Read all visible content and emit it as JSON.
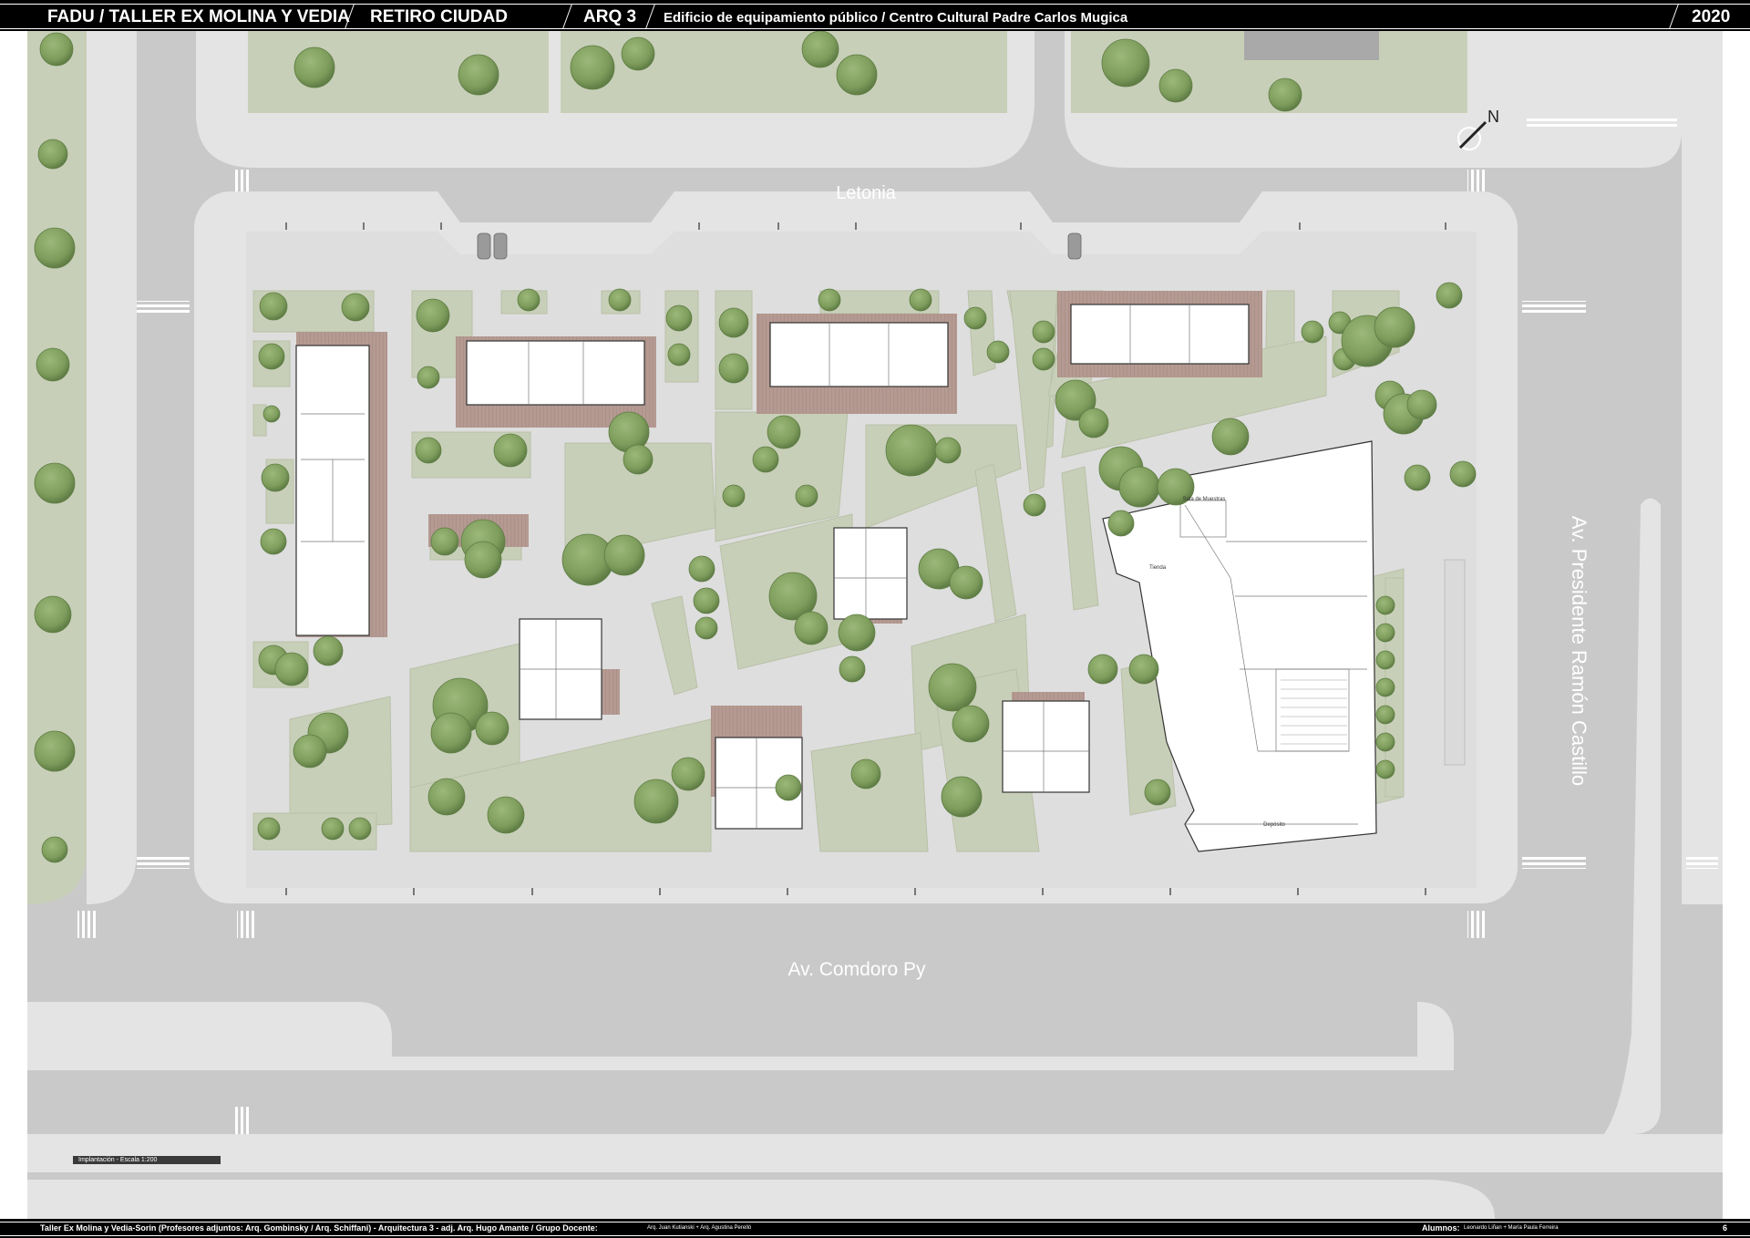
{
  "header": {
    "title": "FADU / TALLER EX MOLINA Y VEDIA",
    "site": "RETIRO CIUDAD",
    "course": "ARQ 3",
    "project": "Edificio de equipamiento público / Centro Cultural Padre Carlos Mugica",
    "year": "2020"
  },
  "footer": {
    "credits": "Taller Ex Molina y Vedia-Sorin (Profesores adjuntos:  Arq. Gombinsky / Arq. Schiffani) - Arquitectura 3 - adj. Arq. Hugo Amante / Grupo Docente:",
    "teachers": "Arq. Juan Kutianski + Arq. Agustina Perelló",
    "students_label": "Alumnos:",
    "students": "Leonardo Liñan + María Paula Ferreira",
    "page": "6"
  },
  "map": {
    "streets": {
      "north": "Letonia",
      "south": "Av. Comdoro Py",
      "east": "Av. Presidente Ramón Castillo"
    },
    "north_arrow": "N",
    "scale_label": "Implantación - Escala 1:200",
    "rooms": {
      "sala": "Sala de Muestras",
      "tienda": "Tienda",
      "deposito": "Depósito"
    },
    "colors": {
      "road": "#c9c9c9",
      "sidewalk": "#e4e4e4",
      "plaza": "#dedede",
      "grass": "#c8cfb8",
      "tree": "#7e9d5c",
      "deck": "#b49a92",
      "building": "#ffffff"
    }
  }
}
